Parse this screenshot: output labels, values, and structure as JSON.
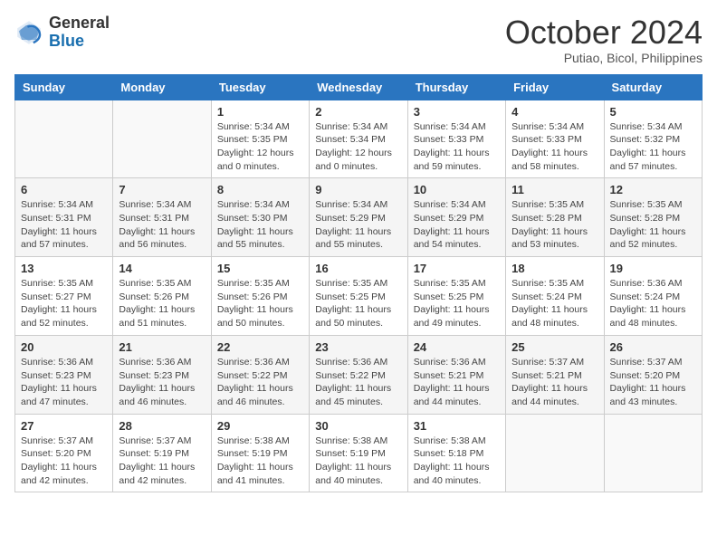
{
  "header": {
    "logo_general": "General",
    "logo_blue": "Blue",
    "month_title": "October 2024",
    "subtitle": "Putiao, Bicol, Philippines"
  },
  "weekdays": [
    "Sunday",
    "Monday",
    "Tuesday",
    "Wednesday",
    "Thursday",
    "Friday",
    "Saturday"
  ],
  "weeks": [
    [
      {
        "day": "",
        "info": ""
      },
      {
        "day": "",
        "info": ""
      },
      {
        "day": "1",
        "info": "Sunrise: 5:34 AM\nSunset: 5:35 PM\nDaylight: 12 hours\nand 0 minutes."
      },
      {
        "day": "2",
        "info": "Sunrise: 5:34 AM\nSunset: 5:34 PM\nDaylight: 12 hours\nand 0 minutes."
      },
      {
        "day": "3",
        "info": "Sunrise: 5:34 AM\nSunset: 5:33 PM\nDaylight: 11 hours\nand 59 minutes."
      },
      {
        "day": "4",
        "info": "Sunrise: 5:34 AM\nSunset: 5:33 PM\nDaylight: 11 hours\nand 58 minutes."
      },
      {
        "day": "5",
        "info": "Sunrise: 5:34 AM\nSunset: 5:32 PM\nDaylight: 11 hours\nand 57 minutes."
      }
    ],
    [
      {
        "day": "6",
        "info": "Sunrise: 5:34 AM\nSunset: 5:31 PM\nDaylight: 11 hours\nand 57 minutes."
      },
      {
        "day": "7",
        "info": "Sunrise: 5:34 AM\nSunset: 5:31 PM\nDaylight: 11 hours\nand 56 minutes."
      },
      {
        "day": "8",
        "info": "Sunrise: 5:34 AM\nSunset: 5:30 PM\nDaylight: 11 hours\nand 55 minutes."
      },
      {
        "day": "9",
        "info": "Sunrise: 5:34 AM\nSunset: 5:29 PM\nDaylight: 11 hours\nand 55 minutes."
      },
      {
        "day": "10",
        "info": "Sunrise: 5:34 AM\nSunset: 5:29 PM\nDaylight: 11 hours\nand 54 minutes."
      },
      {
        "day": "11",
        "info": "Sunrise: 5:35 AM\nSunset: 5:28 PM\nDaylight: 11 hours\nand 53 minutes."
      },
      {
        "day": "12",
        "info": "Sunrise: 5:35 AM\nSunset: 5:28 PM\nDaylight: 11 hours\nand 52 minutes."
      }
    ],
    [
      {
        "day": "13",
        "info": "Sunrise: 5:35 AM\nSunset: 5:27 PM\nDaylight: 11 hours\nand 52 minutes."
      },
      {
        "day": "14",
        "info": "Sunrise: 5:35 AM\nSunset: 5:26 PM\nDaylight: 11 hours\nand 51 minutes."
      },
      {
        "day": "15",
        "info": "Sunrise: 5:35 AM\nSunset: 5:26 PM\nDaylight: 11 hours\nand 50 minutes."
      },
      {
        "day": "16",
        "info": "Sunrise: 5:35 AM\nSunset: 5:25 PM\nDaylight: 11 hours\nand 50 minutes."
      },
      {
        "day": "17",
        "info": "Sunrise: 5:35 AM\nSunset: 5:25 PM\nDaylight: 11 hours\nand 49 minutes."
      },
      {
        "day": "18",
        "info": "Sunrise: 5:35 AM\nSunset: 5:24 PM\nDaylight: 11 hours\nand 48 minutes."
      },
      {
        "day": "19",
        "info": "Sunrise: 5:36 AM\nSunset: 5:24 PM\nDaylight: 11 hours\nand 48 minutes."
      }
    ],
    [
      {
        "day": "20",
        "info": "Sunrise: 5:36 AM\nSunset: 5:23 PM\nDaylight: 11 hours\nand 47 minutes."
      },
      {
        "day": "21",
        "info": "Sunrise: 5:36 AM\nSunset: 5:23 PM\nDaylight: 11 hours\nand 46 minutes."
      },
      {
        "day": "22",
        "info": "Sunrise: 5:36 AM\nSunset: 5:22 PM\nDaylight: 11 hours\nand 46 minutes."
      },
      {
        "day": "23",
        "info": "Sunrise: 5:36 AM\nSunset: 5:22 PM\nDaylight: 11 hours\nand 45 minutes."
      },
      {
        "day": "24",
        "info": "Sunrise: 5:36 AM\nSunset: 5:21 PM\nDaylight: 11 hours\nand 44 minutes."
      },
      {
        "day": "25",
        "info": "Sunrise: 5:37 AM\nSunset: 5:21 PM\nDaylight: 11 hours\nand 44 minutes."
      },
      {
        "day": "26",
        "info": "Sunrise: 5:37 AM\nSunset: 5:20 PM\nDaylight: 11 hours\nand 43 minutes."
      }
    ],
    [
      {
        "day": "27",
        "info": "Sunrise: 5:37 AM\nSunset: 5:20 PM\nDaylight: 11 hours\nand 42 minutes."
      },
      {
        "day": "28",
        "info": "Sunrise: 5:37 AM\nSunset: 5:19 PM\nDaylight: 11 hours\nand 42 minutes."
      },
      {
        "day": "29",
        "info": "Sunrise: 5:38 AM\nSunset: 5:19 PM\nDaylight: 11 hours\nand 41 minutes."
      },
      {
        "day": "30",
        "info": "Sunrise: 5:38 AM\nSunset: 5:19 PM\nDaylight: 11 hours\nand 40 minutes."
      },
      {
        "day": "31",
        "info": "Sunrise: 5:38 AM\nSunset: 5:18 PM\nDaylight: 11 hours\nand 40 minutes."
      },
      {
        "day": "",
        "info": ""
      },
      {
        "day": "",
        "info": ""
      }
    ]
  ]
}
